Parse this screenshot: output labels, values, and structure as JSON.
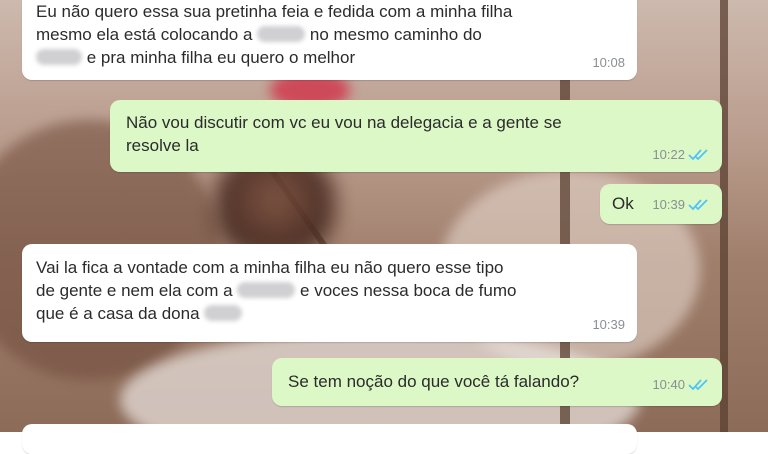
{
  "theme": {
    "incoming_bg": "#ffffff",
    "outgoing_bg": "#dcf8c6",
    "read_tick_color": "#4fc3f7",
    "time_color": "#8a8f93"
  },
  "messages": [
    {
      "direction": "in",
      "lines": [
        "Eu não quero essa sua pretinha feia e fedida com a minha filha",
        "mesmo ela está colocando a",
        "no mesmo caminho do",
        "e pra minha filha eu quero o melhor"
      ],
      "time": "10:08"
    },
    {
      "direction": "out",
      "lines": [
        "Não vou discutir com vc eu vou na delegacia e a gente se",
        "resolve la"
      ],
      "time": "10:22",
      "status": "read"
    },
    {
      "direction": "out",
      "text": "Ok",
      "time": "10:39",
      "status": "read"
    },
    {
      "direction": "in",
      "lines": [
        "Vai la fica a vontade com a minha filha eu não quero esse tipo",
        "de gente e nem ela com a",
        "e voces nessa boca de fumo",
        "que é a casa da dona"
      ],
      "time": "10:39"
    },
    {
      "direction": "out",
      "text": "Se tem noção do que você tá falando?",
      "time": "10:40",
      "status": "read"
    }
  ],
  "icons": {
    "read_receipt": "double-check-icon"
  }
}
